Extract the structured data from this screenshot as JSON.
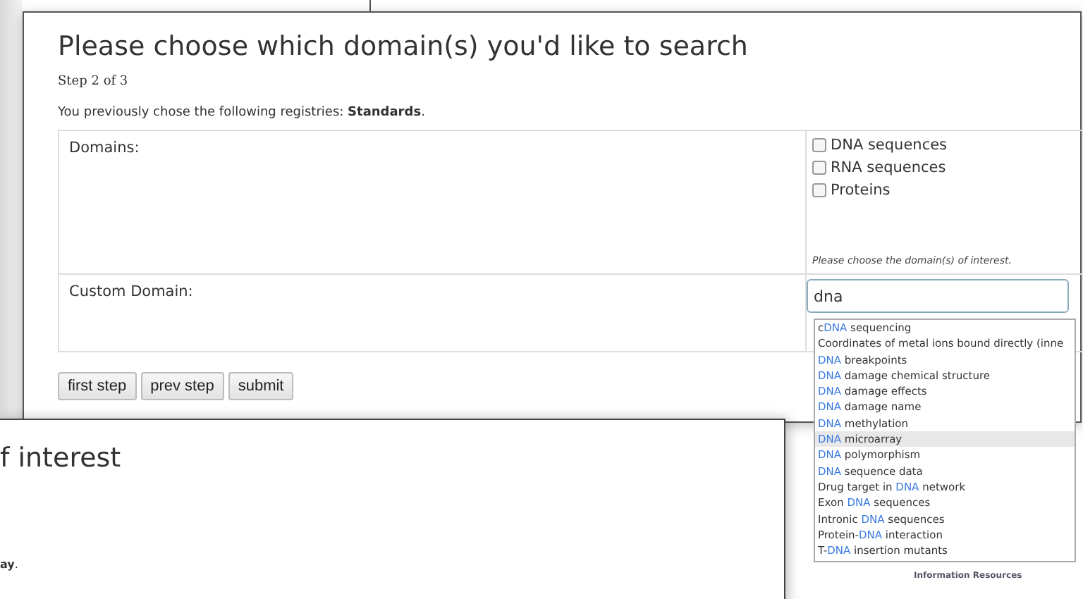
{
  "search_window": {
    "title": "Please choose which domain(s) you'd like to search",
    "step": "Step 2 of 3",
    "registries_note": "You previously chose the following registries: **Standards**.",
    "domains": {
      "label": "Domains:",
      "options": [
        {
          "label": "DNA sequences",
          "checked": false
        },
        {
          "label": "RNA sequences",
          "checked": false
        },
        {
          "label": "Proteins",
          "checked": false
        }
      ],
      "hint": "Please choose the domain(s) of interest."
    },
    "custom_domain": {
      "label": "Custom Domain:",
      "value": "dna"
    },
    "buttons": [
      "first step",
      "prev step",
      "submit"
    ]
  },
  "autocomplete": {
    "items": [
      {
        "prefix": "c",
        "match": "DNA",
        "suffix": " sequencing",
        "selected": false
      },
      {
        "prefix": "Coordinates of metal ions bound directly (inne",
        "selected": false
      },
      {
        "match": "DNA",
        "suffix": " breakpoints",
        "selected": false
      },
      {
        "match": "DNA",
        "suffix": " damage chemical structure",
        "selected": false
      },
      {
        "match": "DNA",
        "suffix": " damage effects",
        "selected": false
      },
      {
        "match": "DNA",
        "suffix": " damage name",
        "selected": false
      },
      {
        "match": "DNA",
        "suffix": " methylation",
        "selected": false
      },
      {
        "match": "DNA",
        "suffix": " microarray",
        "selected": true
      },
      {
        "match": "DNA",
        "suffix": " polymorphism",
        "selected": false
      },
      {
        "match": "DNA",
        "suffix": " sequence data",
        "selected": false
      },
      {
        "prefix": "Drug target in ",
        "match": "DNA",
        "suffix": " network",
        "selected": false
      },
      {
        "prefix": "Exon ",
        "match": "DNA",
        "suffix": " sequences",
        "selected": false
      },
      {
        "prefix": "Intronic ",
        "match": "DNA",
        "suffix": " sequences",
        "selected": false
      },
      {
        "prefix": "Protein-",
        "match": "DNA",
        "suffix": " interaction",
        "selected": false
      },
      {
        "prefix": "T-",
        "match": "DNA",
        "suffix": " insertion mutants",
        "selected": false
      }
    ]
  },
  "footer_text": "Information Resources",
  "second_window": {
    "title": "f interest",
    "note": "**ay**."
  }
}
